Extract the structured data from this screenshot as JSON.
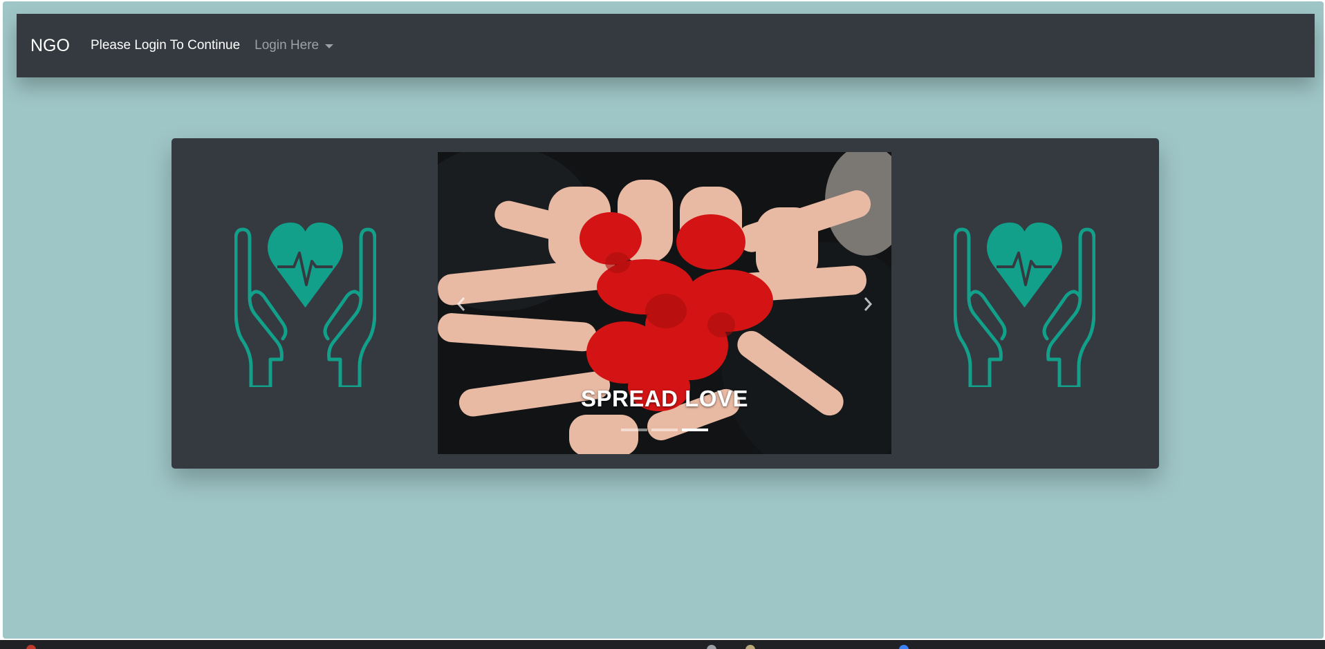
{
  "navbar": {
    "brand": "NGO",
    "message": "Please Login To Continue",
    "login_dropdown": "Login Here"
  },
  "icons": {
    "left": "heart-in-hands-icon",
    "right": "heart-in-hands-icon",
    "prev": "chevron-left-icon",
    "next": "chevron-right-icon"
  },
  "carousel": {
    "caption": "SPREAD LOVE",
    "slide_count": 3,
    "active_index": 2
  },
  "colors": {
    "page_bg": "#9fc6c7",
    "navbar_bg": "#343a40",
    "accent": "#13a08a"
  }
}
